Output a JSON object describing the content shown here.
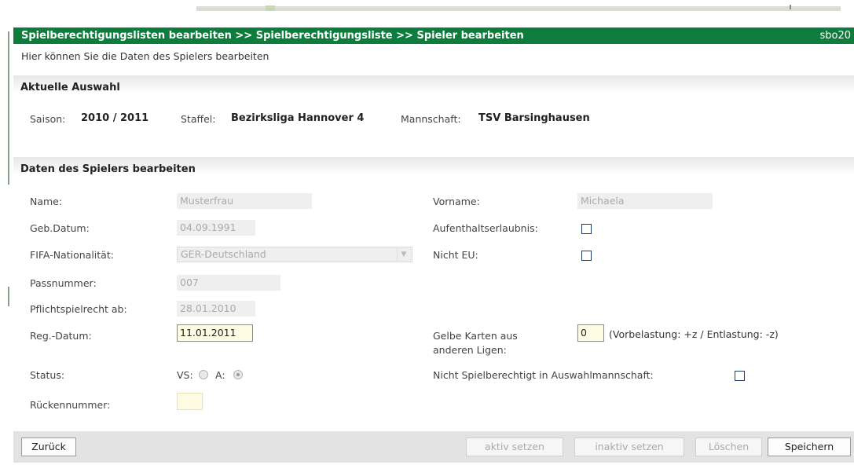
{
  "header": {
    "breadcrumb": "Spielberechtigungslisten bearbeiten >> Spielberechtigungsliste >> Spieler bearbeiten",
    "page_code": "sbo20"
  },
  "intro": "Hier können Sie die Daten des Spielers bearbeiten",
  "selection": {
    "title": "Aktuelle Auswahl",
    "season_label": "Saison:",
    "season_value": "2010 / 2011",
    "league_label": "Staffel:",
    "league_value": "Bezirksliga Hannover 4",
    "team_label": "Mannschaft:",
    "team_value": "TSV Barsinghausen"
  },
  "player": {
    "title": "Daten des Spielers bearbeiten",
    "name_label": "Name:",
    "name_value": "Musterfrau",
    "firstname_label": "Vorname:",
    "firstname_value": "Michaela",
    "dob_label": "Geb.Datum:",
    "dob_value": "04.09.1991",
    "residence_label": "Aufenthaltserlaubnis:",
    "residence_checked": false,
    "nationality_label": "FIFA-Nationalität:",
    "nationality_value": "GER-Deutschland",
    "non_eu_label": "Nicht EU:",
    "non_eu_checked": false,
    "passport_label": "Passnummer:",
    "passport_value": "007",
    "mandatory_label": "Pflichtspielrecht ab:",
    "mandatory_value": "28.01.2010",
    "regdate_label": "Reg.-Datum:",
    "regdate_value": "11.01.2011",
    "yellow_label_line1": "Gelbe Karten aus",
    "yellow_label_line2": "anderen Ligen:",
    "yellow_value": "0",
    "yellow_hint": "(Vorbelastung: +z / Entlastung: -z)",
    "status_label": "Status:",
    "status_vs_label": "VS:",
    "status_a_label": "A:",
    "status_selected": "A",
    "not_eligible_label": "Nicht Spielberechtigt in Auswahlmannschaft:",
    "not_eligible_checked": false,
    "jersey_label": "Rückennummer:",
    "jersey_value": ""
  },
  "buttons": {
    "back": "Zurück",
    "activate": "aktiv setzen",
    "deactivate": "inaktiv setzen",
    "delete": "Löschen",
    "save": "Speichern"
  }
}
